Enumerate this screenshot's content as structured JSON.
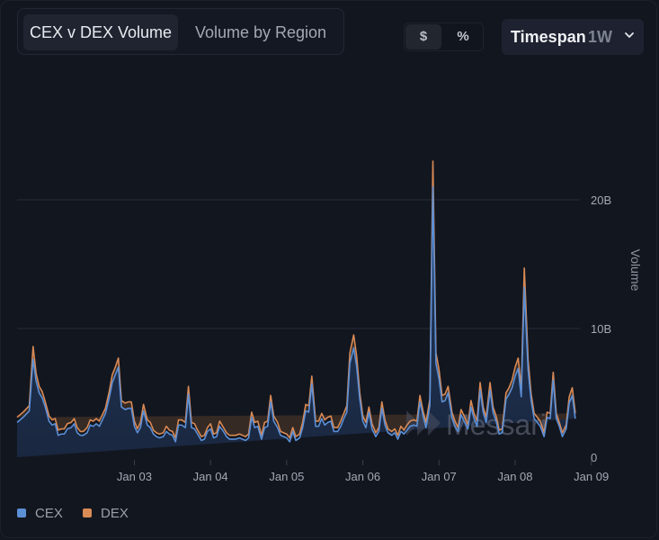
{
  "tabs": [
    {
      "label": "CEX v DEX Volume",
      "active": true
    },
    {
      "label": "Volume by Region",
      "active": false
    }
  ],
  "unit_toggle": {
    "dollar": "$",
    "percent": "%",
    "selected": "$"
  },
  "timespan": {
    "label": "Timespan",
    "value": "1W"
  },
  "watermark": "Messari",
  "colors": {
    "cex": "#5b8fd6",
    "dex": "#d98a55",
    "area": "#1b2740",
    "grid": "#272c37"
  },
  "chart_data": {
    "type": "area",
    "stacked": true,
    "title": "CEX v DEX Volume",
    "xlabel": "",
    "ylabel": "Volume",
    "ylim": [
      0,
      20000000000
    ],
    "yticks": [
      {
        "value": 0,
        "label": "0"
      },
      {
        "value": 10000000000,
        "label": "10B"
      },
      {
        "value": 20000000000,
        "label": "20B"
      }
    ],
    "xticks": [
      {
        "day": 1,
        "label": "Jan 03"
      },
      {
        "day": 2,
        "label": "Jan 04"
      },
      {
        "day": 3,
        "label": "Jan 05"
      },
      {
        "day": 4,
        "label": "Jan 06"
      },
      {
        "day": 5,
        "label": "Jan 07"
      },
      {
        "day": 6,
        "label": "Jan 08"
      },
      {
        "day": 7,
        "label": "Jan 09"
      }
    ],
    "x_unit": "days since Jan 03 00:00",
    "xlim": [
      -0.54,
      6.85
    ],
    "grid": "horizontal",
    "legend": "bottom-left",
    "x": [
      -0.54,
      -0.46,
      -0.38,
      -0.33,
      -0.29,
      -0.25,
      -0.21,
      -0.17,
      -0.12,
      -0.08,
      -0.04,
      0.0,
      0.04,
      0.08,
      0.12,
      0.17,
      0.21,
      0.25,
      0.29,
      0.33,
      0.38,
      0.42,
      0.46,
      0.5,
      0.54,
      0.58,
      0.62,
      0.67,
      0.71,
      0.75,
      0.79,
      0.83,
      0.88,
      0.92,
      0.96,
      1.0,
      1.04,
      1.08,
      1.12,
      1.17,
      1.21,
      1.25,
      1.29,
      1.33,
      1.38,
      1.42,
      1.46,
      1.5,
      1.54,
      1.58,
      1.62,
      1.67,
      1.71,
      1.75,
      1.79,
      1.83,
      1.88,
      1.92,
      1.96,
      2.0,
      2.04,
      2.08,
      2.12,
      2.17,
      2.21,
      2.25,
      2.29,
      2.33,
      2.38,
      2.42,
      2.46,
      2.5,
      2.54,
      2.58,
      2.62,
      2.67,
      2.71,
      2.75,
      2.79,
      2.83,
      2.88,
      2.92,
      2.96,
      3.0,
      3.04,
      3.08,
      3.12,
      3.17,
      3.21,
      3.25,
      3.29,
      3.33,
      3.38,
      3.42,
      3.46,
      3.5,
      3.54,
      3.58,
      3.62,
      3.67,
      3.71,
      3.75,
      3.79,
      3.83,
      3.88,
      3.92,
      3.96,
      4.0,
      4.04,
      4.08,
      4.12,
      4.17,
      4.21,
      4.25,
      4.29,
      4.33,
      4.38,
      4.42,
      4.46,
      4.5,
      4.54,
      4.58,
      4.62,
      4.67,
      4.71,
      4.75,
      4.79,
      4.83,
      4.88,
      4.92,
      4.96,
      5.0,
      5.04,
      5.08,
      5.12,
      5.17,
      5.21,
      5.25,
      5.29,
      5.33,
      5.38,
      5.42,
      5.46,
      5.5,
      5.54,
      5.58,
      5.62,
      5.67,
      5.71,
      5.75,
      5.79,
      5.83,
      5.88,
      5.92,
      5.96,
      6.0,
      6.04,
      6.08,
      6.12,
      6.17,
      6.21,
      6.25,
      6.29,
      6.33,
      6.38,
      6.42,
      6.46,
      6.5,
      6.54,
      6.58,
      6.62,
      6.67,
      6.71,
      6.75,
      6.79,
      6.85
    ],
    "series": [
      {
        "name": "CEX",
        "color": "#5b8fd6",
        "values": [
          2.7,
          3.1,
          3.6,
          7.6,
          5.9,
          5.0,
          4.6,
          3.9,
          2.8,
          2.5,
          2.6,
          1.7,
          1.8,
          1.8,
          2.2,
          2.3,
          2.6,
          1.9,
          1.7,
          1.7,
          1.9,
          2.5,
          2.4,
          2.6,
          2.4,
          2.9,
          3.4,
          4.6,
          5.8,
          6.4,
          7.0,
          3.9,
          3.7,
          3.8,
          3.8,
          2.4,
          1.9,
          2.3,
          3.6,
          2.5,
          2.3,
          1.8,
          1.6,
          1.5,
          1.6,
          2.0,
          1.8,
          1.7,
          1.2,
          2.5,
          2.5,
          2.3,
          4.9,
          2.3,
          2.2,
          1.8,
          1.3,
          1.4,
          2.0,
          2.2,
          1.5,
          1.6,
          2.4,
          2.0,
          1.6,
          1.4,
          1.4,
          1.4,
          1.5,
          1.4,
          1.3,
          1.5,
          3.1,
          2.3,
          2.4,
          1.4,
          2.3,
          2.4,
          4.3,
          2.8,
          2.3,
          1.7,
          1.6,
          1.5,
          1.2,
          2.0,
          1.3,
          1.5,
          2.3,
          3.6,
          3.5,
          5.7,
          2.4,
          2.4,
          3.0,
          2.5,
          2.7,
          2.8,
          2.0,
          2.0,
          2.4,
          3.0,
          3.5,
          7.3,
          8.5,
          7.0,
          4.5,
          2.8,
          2.3,
          3.5,
          2.2,
          1.6,
          2.0,
          3.8,
          2.5,
          1.9,
          1.7,
          1.9,
          1.4,
          2.0,
          1.8,
          2.1,
          2.4,
          2.5,
          2.4,
          4.3,
          3.2,
          2.3,
          4.0,
          21.0,
          7.3,
          6.1,
          4.3,
          4.4,
          5.0,
          3.1,
          2.4,
          2.0,
          3.3,
          2.8,
          2.2,
          3.9,
          3.0,
          2.4,
          5.2,
          3.5,
          2.7,
          5.2,
          3.5,
          2.8,
          1.8,
          1.9,
          4.5,
          4.9,
          5.4,
          6.3,
          6.9,
          4.7,
          13.2,
          6.8,
          4.4,
          3.0,
          2.7,
          2.4,
          1.6,
          3.1,
          3.0,
          6.0,
          3.0,
          2.4,
          1.6,
          2.2,
          4.2,
          4.8,
          3.0
        ]
      },
      {
        "name": "DEX",
        "color": "#d98a55",
        "values": [
          0.4,
          0.4,
          0.4,
          1.0,
          0.6,
          0.5,
          0.5,
          0.4,
          0.4,
          0.4,
          0.4,
          0.4,
          0.4,
          0.4,
          0.4,
          0.4,
          0.4,
          0.4,
          0.3,
          0.3,
          0.4,
          0.4,
          0.4,
          0.4,
          0.4,
          0.4,
          0.4,
          0.5,
          0.6,
          0.6,
          0.7,
          0.5,
          0.5,
          0.5,
          0.5,
          0.4,
          0.3,
          0.4,
          0.5,
          0.4,
          0.4,
          0.3,
          0.3,
          0.3,
          0.3,
          0.4,
          0.3,
          0.3,
          0.3,
          0.4,
          0.4,
          0.4,
          0.6,
          0.4,
          0.4,
          0.3,
          0.3,
          0.3,
          0.3,
          0.4,
          0.3,
          0.3,
          0.4,
          0.3,
          0.3,
          0.3,
          0.3,
          0.3,
          0.3,
          0.3,
          0.3,
          0.3,
          0.4,
          0.4,
          0.4,
          0.3,
          0.4,
          0.4,
          0.5,
          0.4,
          0.4,
          0.3,
          0.3,
          0.3,
          0.3,
          0.3,
          0.3,
          0.3,
          0.4,
          0.5,
          0.5,
          0.6,
          0.4,
          0.4,
          0.4,
          0.4,
          0.4,
          0.4,
          0.3,
          0.3,
          0.4,
          0.4,
          0.5,
          0.8,
          1.0,
          0.8,
          0.5,
          0.4,
          0.4,
          0.4,
          0.4,
          0.3,
          0.3,
          0.5,
          0.4,
          0.3,
          0.3,
          0.3,
          0.3,
          0.4,
          0.3,
          0.4,
          0.4,
          0.4,
          0.4,
          0.5,
          0.4,
          0.4,
          0.5,
          2.0,
          0.8,
          0.7,
          0.5,
          0.5,
          0.5,
          0.4,
          0.4,
          0.3,
          0.4,
          0.4,
          0.3,
          0.5,
          0.4,
          0.4,
          0.6,
          0.4,
          0.4,
          0.6,
          0.4,
          0.4,
          0.3,
          0.3,
          0.5,
          0.5,
          0.6,
          0.7,
          0.8,
          0.6,
          1.5,
          0.8,
          0.5,
          0.4,
          0.4,
          0.4,
          0.3,
          0.4,
          0.4,
          0.6,
          0.4,
          0.3,
          0.3,
          0.3,
          0.5,
          0.6,
          0.4
        ]
      }
    ],
    "value_unit": "billions USD"
  },
  "legend": [
    {
      "label": "CEX",
      "color": "#5b8fd6"
    },
    {
      "label": "DEX",
      "color": "#d98a55"
    }
  ]
}
